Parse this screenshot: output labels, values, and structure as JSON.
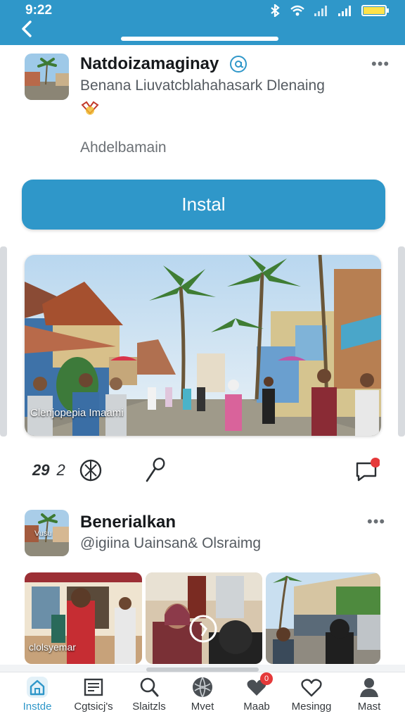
{
  "status_bar": {
    "time": "9:22"
  },
  "post1": {
    "name": "Natdoizamaginay",
    "subtitle": "Benana Liuvatcblahahasark Dlenaing",
    "meta": "Ahdelbamain",
    "install_label": "Instal",
    "photo_caption": "Clenjopepia Imaami",
    "verified_icon": "verified-badge-icon",
    "emblem_icon": "emblem-icon"
  },
  "actions": {
    "like_count": "29",
    "like_suffix": "2",
    "chat_badge": "?"
  },
  "post2": {
    "name": "Benerialkan",
    "handle": "@igiina Uainsan& Olsraimg",
    "avatar_caption": "Vusu",
    "thumb1_caption": "clolsyemar"
  },
  "nav": {
    "items": [
      {
        "label": "Instde",
        "icon": "home-icon",
        "active": true
      },
      {
        "label": "Cgtsicj's",
        "icon": "catalog-icon"
      },
      {
        "label": "Slaitzls",
        "icon": "search-icon"
      },
      {
        "label": "Mvet",
        "icon": "globe-icon"
      },
      {
        "label": "Maab",
        "icon": "heart-icon",
        "badge": "0"
      },
      {
        "label": "Mesingg",
        "icon": "heart-outline-icon"
      },
      {
        "label": "Mast",
        "icon": "profile-icon"
      }
    ]
  },
  "colors": {
    "accent": "#2f97c9",
    "badge": "#e5393a"
  }
}
